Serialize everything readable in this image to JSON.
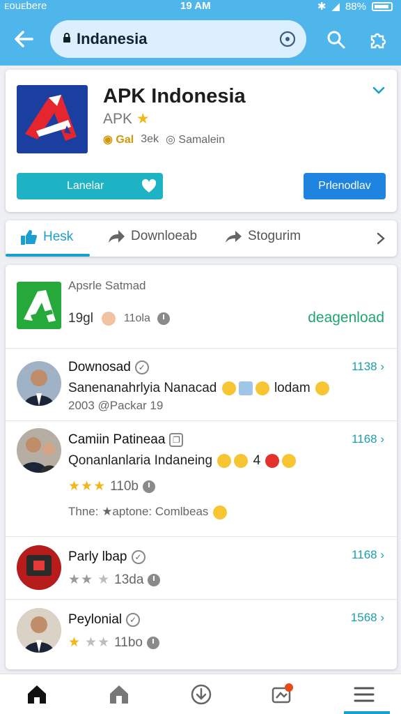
{
  "status_bar": {
    "carrier": "ᴇᴏuᴇbere",
    "time": "19 AM",
    "battery": "88%"
  },
  "address_bar": {
    "url_text": "Indanesia"
  },
  "app": {
    "title": "APK Indonesia",
    "subtitle": "APK",
    "badge": "Gal",
    "size": "3ek",
    "developer": "Samalein",
    "primary_button": "Lanelar",
    "secondary_button": "Prlenodlav"
  },
  "tabs": [
    {
      "label": "Hesk",
      "active": true
    },
    {
      "label": "Downloeab",
      "active": false
    },
    {
      "label": "Stogurim",
      "active": false
    }
  ],
  "top_item": {
    "name": "Apsrle Satmad",
    "count": "19gl",
    "meta": "11ola",
    "action": "deagenload"
  },
  "reviews": [
    {
      "name": "Downosad",
      "text": "Sanenanahrlyia Nanacad",
      "text2": "lodam",
      "sub": "2003 @Packar 19",
      "time": "1138"
    },
    {
      "name": "Camiin Patineaa",
      "text": "Qonanlanlaria Indaneing",
      "text2": "4",
      "rating_meta": "110b",
      "stars": 3,
      "sub": "Thne: ★aptone: Comlbeas",
      "time": "1168"
    },
    {
      "name": "Parly lbap",
      "rating_meta": "13da",
      "stars": 2,
      "time": "1168"
    },
    {
      "name": "Peylonial",
      "rating_meta": "11bo",
      "stars": 1,
      "time": "1568"
    }
  ],
  "colors": {
    "accent": "#1a9fd0",
    "header": "#4fb6ec",
    "star": "#f3b617",
    "download_text": "#1fa572"
  }
}
